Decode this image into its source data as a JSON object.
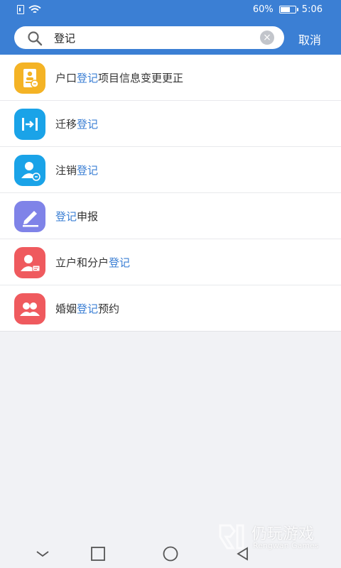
{
  "status": {
    "battery": "60%",
    "battery_level": 0.6,
    "time": "5:06"
  },
  "search": {
    "query": "登记",
    "cancel_label": "取消"
  },
  "results": [
    {
      "pre": "户口",
      "hl": "登记",
      "post": "项目信息变更更正",
      "icon": "household-id-card-icon",
      "color": "#f4b325"
    },
    {
      "pre": "迁移",
      "hl": "登记",
      "post": "",
      "icon": "transfer-icon",
      "color": "#1aa3e8"
    },
    {
      "pre": "注销",
      "hl": "登记",
      "post": "",
      "icon": "user-cancel-icon",
      "color": "#1aa3e8"
    },
    {
      "pre": "",
      "hl": "登记",
      "post": "申报",
      "icon": "pencil-icon",
      "color": "#7f83e8"
    },
    {
      "pre": "立户和分户",
      "hl": "登记",
      "post": "",
      "icon": "user-card-icon",
      "color": "#ef5a5e"
    },
    {
      "pre": "婚姻",
      "hl": "登记",
      "post": "预约",
      "icon": "couple-icon",
      "color": "#ef5a5e"
    }
  ],
  "watermark": {
    "title": "仍玩游戏",
    "subtitle": "Rengwan Games"
  }
}
